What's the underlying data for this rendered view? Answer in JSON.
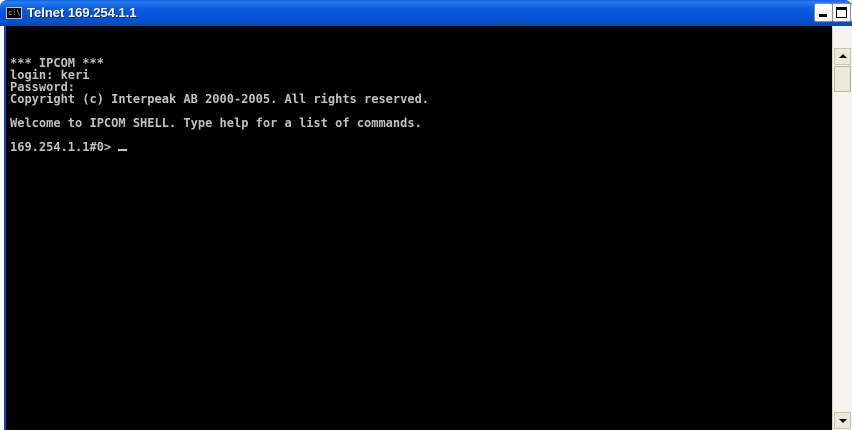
{
  "window": {
    "title": "Telnet 169.254.1.1",
    "icon_label": "c:\\",
    "controls": {
      "minimize": "minimize-icon",
      "maximize": "maximize-icon",
      "close": "close-icon"
    }
  },
  "console": {
    "lines": [
      "*** IPCOM ***",
      "login: keri",
      "Password:",
      "Copyright (c) Interpeak AB 2000-2005. All rights reserved.",
      "Welcome to IPCOM SHELL. Type help for a list of commands.",
      "169.254.1.1#0> "
    ],
    "text_color": "#c0c0c0",
    "background_color": "#000000"
  },
  "scrollbar": {
    "up_icon": "scroll-up-arrow-icon",
    "down_icon": "scroll-down-arrow-icon"
  },
  "colors": {
    "titlebar": "#0553d8",
    "title_text": "#ffffff"
  }
}
